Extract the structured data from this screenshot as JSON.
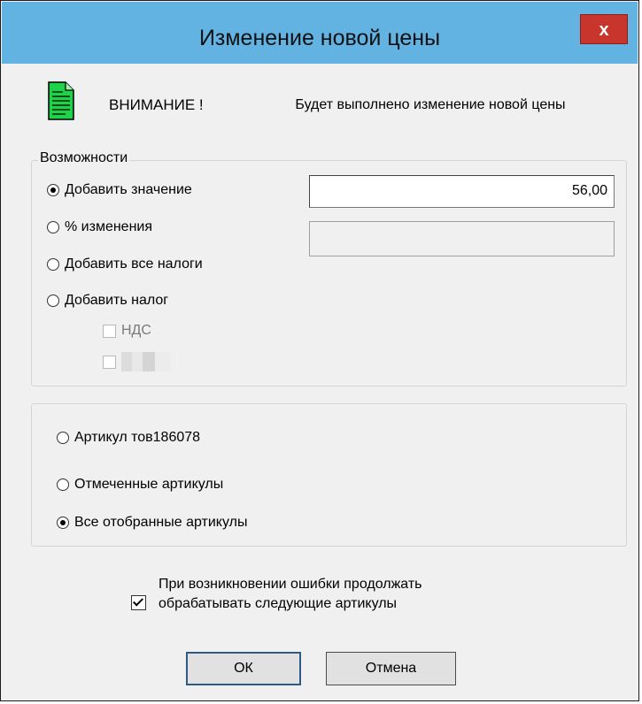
{
  "window": {
    "title": "Изменение новой цены",
    "close_glyph": "x"
  },
  "header": {
    "icon": "notepad-icon",
    "warning_label": "ВНИМАНИЕ !",
    "warning_text": "Будет выполнено изменение новой цены"
  },
  "options_group": {
    "legend": "Возможности",
    "radios": [
      {
        "label": "Добавить значение",
        "checked": true
      },
      {
        "label": "% изменения",
        "checked": false
      },
      {
        "label": "Добавить все налоги",
        "checked": false
      },
      {
        "label": "Добавить налог",
        "checked": false
      }
    ],
    "tax_checkboxes": [
      {
        "label": "НДС",
        "checked": false
      },
      {
        "label": "",
        "checked": false
      }
    ],
    "value_input": "56,00",
    "percent_input": ""
  },
  "scope_group": {
    "radios": [
      {
        "label": "Артикул тов186078",
        "checked": false
      },
      {
        "label": "Отмеченные артикулы",
        "checked": false
      },
      {
        "label": "Все отобранные артикулы",
        "checked": true
      }
    ]
  },
  "continue_on_error": {
    "checked": true,
    "line1": "При возникновении ошибки продолжать",
    "line2": "обрабатывать следующие артикулы"
  },
  "buttons": {
    "ok": "ОК",
    "cancel": "Отмена"
  },
  "colors": {
    "titlebar": "#62b2e2",
    "close": "#c8352c",
    "icon_green": "#1fd24a"
  }
}
